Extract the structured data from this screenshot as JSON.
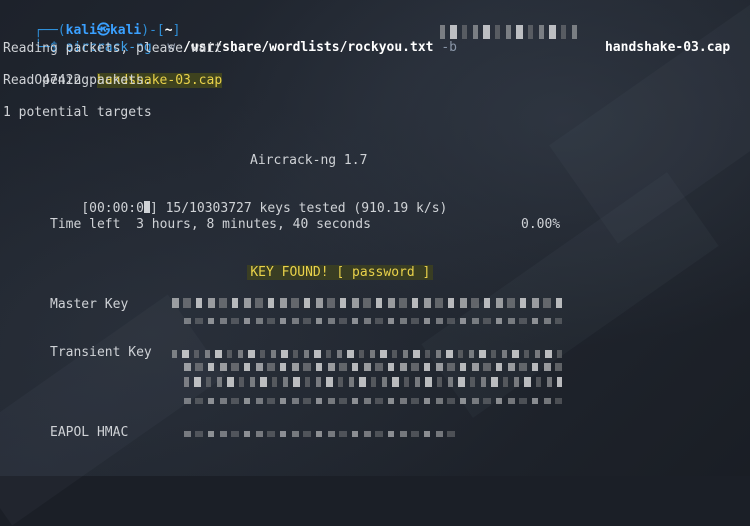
{
  "prompt": {
    "top_open": "┌──(",
    "user": "kali",
    "at": "㉿",
    "host": "kali",
    "top_close": ")-[",
    "cwd": "~",
    "bracket_close": "]",
    "bottom": "└─$ "
  },
  "command": {
    "program": "aircrack-ng",
    "flag_w": "-w",
    "wordlist": "/usr/share/wordlists/rockyou.txt",
    "flag_b": "-b",
    "capfile": "handshake-03.cap"
  },
  "output": {
    "reading": "Reading packets, please wait ...",
    "opening_label": "Opening ",
    "opening_file": "handshake-03.cap",
    "read_packets": "Read 47422 packets.",
    "targets": "1 potential targets",
    "title": "Aircrack-ng 1.7",
    "progress_prefix": "[00:00:0",
    "progress_suffix": "] 15/10303727 keys tested (910.19 k/s)",
    "time_left": "Time left  3 hours, 8 minutes, 40 seconds",
    "percent": "0.00%",
    "key_found": "KEY FOUND! [ password ]",
    "master_key_label": "Master Key",
    "transient_key_label": "Transient Key",
    "eapol_label": "EAPOL HMAC"
  }
}
